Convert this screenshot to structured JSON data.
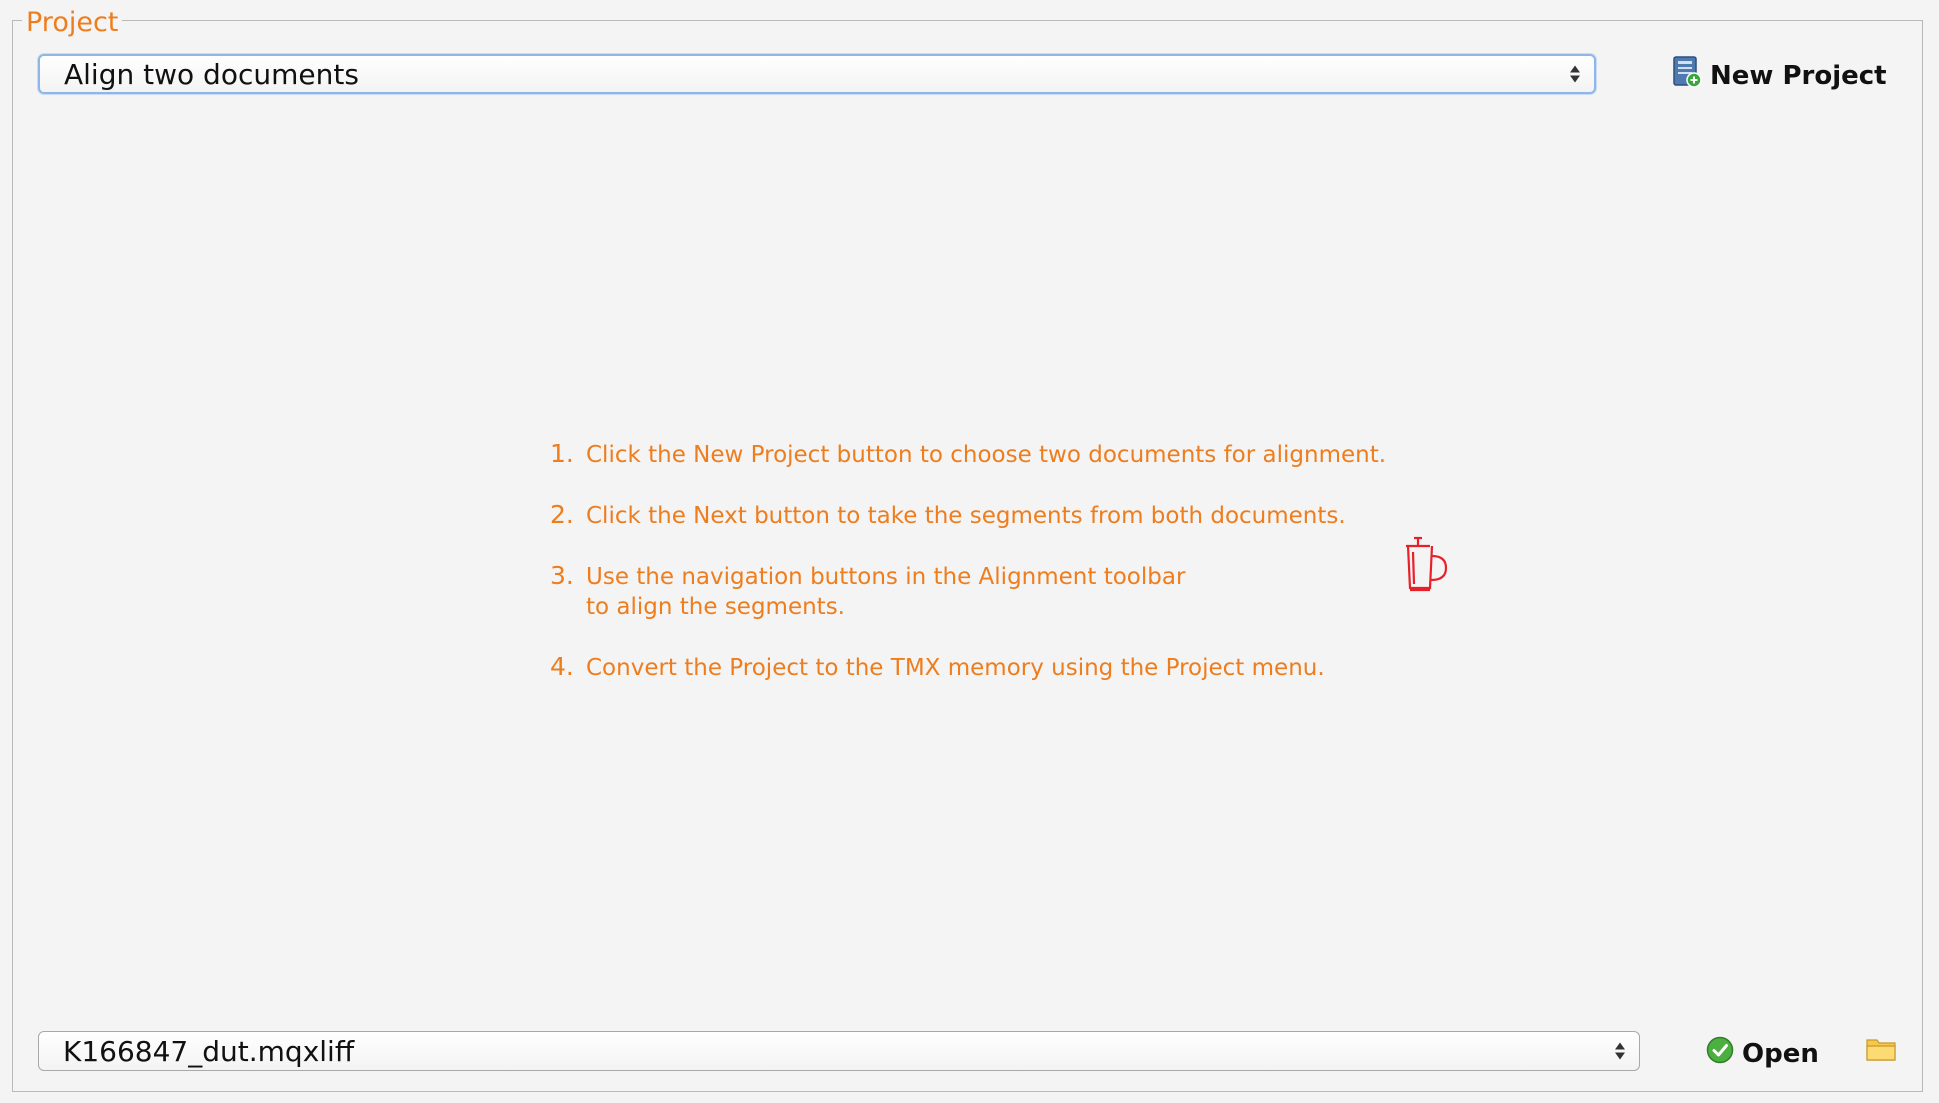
{
  "group": {
    "title": "Project"
  },
  "project_select": {
    "value": "Align two documents"
  },
  "new_project_button": {
    "label": "New Project",
    "icon": "new-project-icon"
  },
  "instructions": [
    {
      "number": "1.",
      "lines": [
        "Click the New Project button to choose two documents for alignment."
      ]
    },
    {
      "number": "2.",
      "lines": [
        "Click the Next button to take the segments from both documents."
      ]
    },
    {
      "number": "3.",
      "lines": [
        "Use the navigation buttons in the Alignment toolbar",
        "to align the segments."
      ]
    },
    {
      "number": "4.",
      "lines": [
        "Convert the Project to the TMX memory using the Project menu."
      ]
    }
  ],
  "file_select": {
    "value": "K166847_dut.mqxliff"
  },
  "open_button": {
    "label": "Open",
    "icon": "checkmark-icon"
  },
  "folder_button": {
    "icon": "folder-icon"
  },
  "colors": {
    "accent": "#ee7d1e",
    "cursor": "#e8202a"
  }
}
